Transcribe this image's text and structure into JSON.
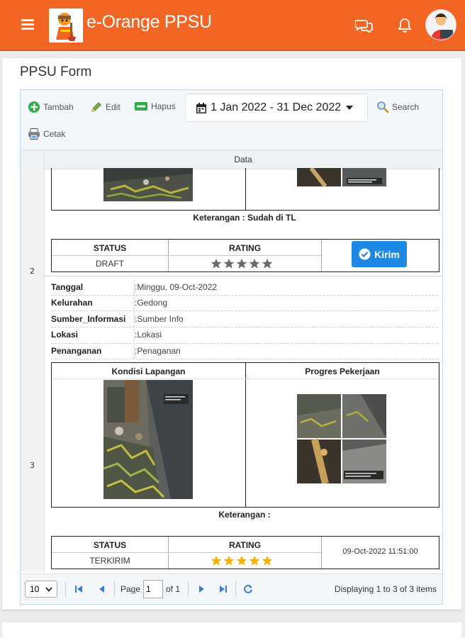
{
  "app": {
    "title": "e-Orange PPSU",
    "brand_color": "#f26522"
  },
  "page": {
    "title": "PPSU Form"
  },
  "toolbar": {
    "add_label": "Tambah",
    "edit_label": "Edit",
    "delete_label": "Hapus",
    "date_range": "1 Jan 2022 - 31 Dec 2022",
    "search_label": "Search",
    "print_label": "Cetak"
  },
  "grid": {
    "column_header": "Data"
  },
  "records": [
    {
      "row_number": "2",
      "keterangan": "Keterangan : Sudah di TL",
      "status_header": "STATUS",
      "rating_header": "RATING",
      "status": "DRAFT",
      "rating": 0,
      "action_label": "Kirim"
    },
    {
      "row_number": "3",
      "fields": [
        {
          "label": "Tanggal",
          "value": ":Minggu, 09-Oct-2022"
        },
        {
          "label": "Kelurahan",
          "value": ":Gedong"
        },
        {
          "label": "Sumber_Informasi",
          "value": ":Sumber Info"
        },
        {
          "label": "Lokasi",
          "value": ":Lokasi"
        },
        {
          "label": "Penanganan",
          "value": ":Penaganan"
        }
      ],
      "photo_header_left": "Kondisi Lapangan",
      "photo_header_right": "Progres Pekerjaan",
      "keterangan": "Keterangan :",
      "status_header": "STATUS",
      "rating_header": "RATING",
      "status": "TERKIRIM",
      "rating": 5,
      "timestamp": "09-Oct-2022 11:51:00"
    }
  ],
  "pager": {
    "page_size": "10",
    "page_label": "Page",
    "page_value": "1",
    "of_label": "of 1",
    "display_text": "Displaying 1 to 3 of 3 items"
  },
  "colors": {
    "star_filled": "#f5b301",
    "star_empty": "#6b6b6b",
    "button_blue": "#1e88e5"
  }
}
